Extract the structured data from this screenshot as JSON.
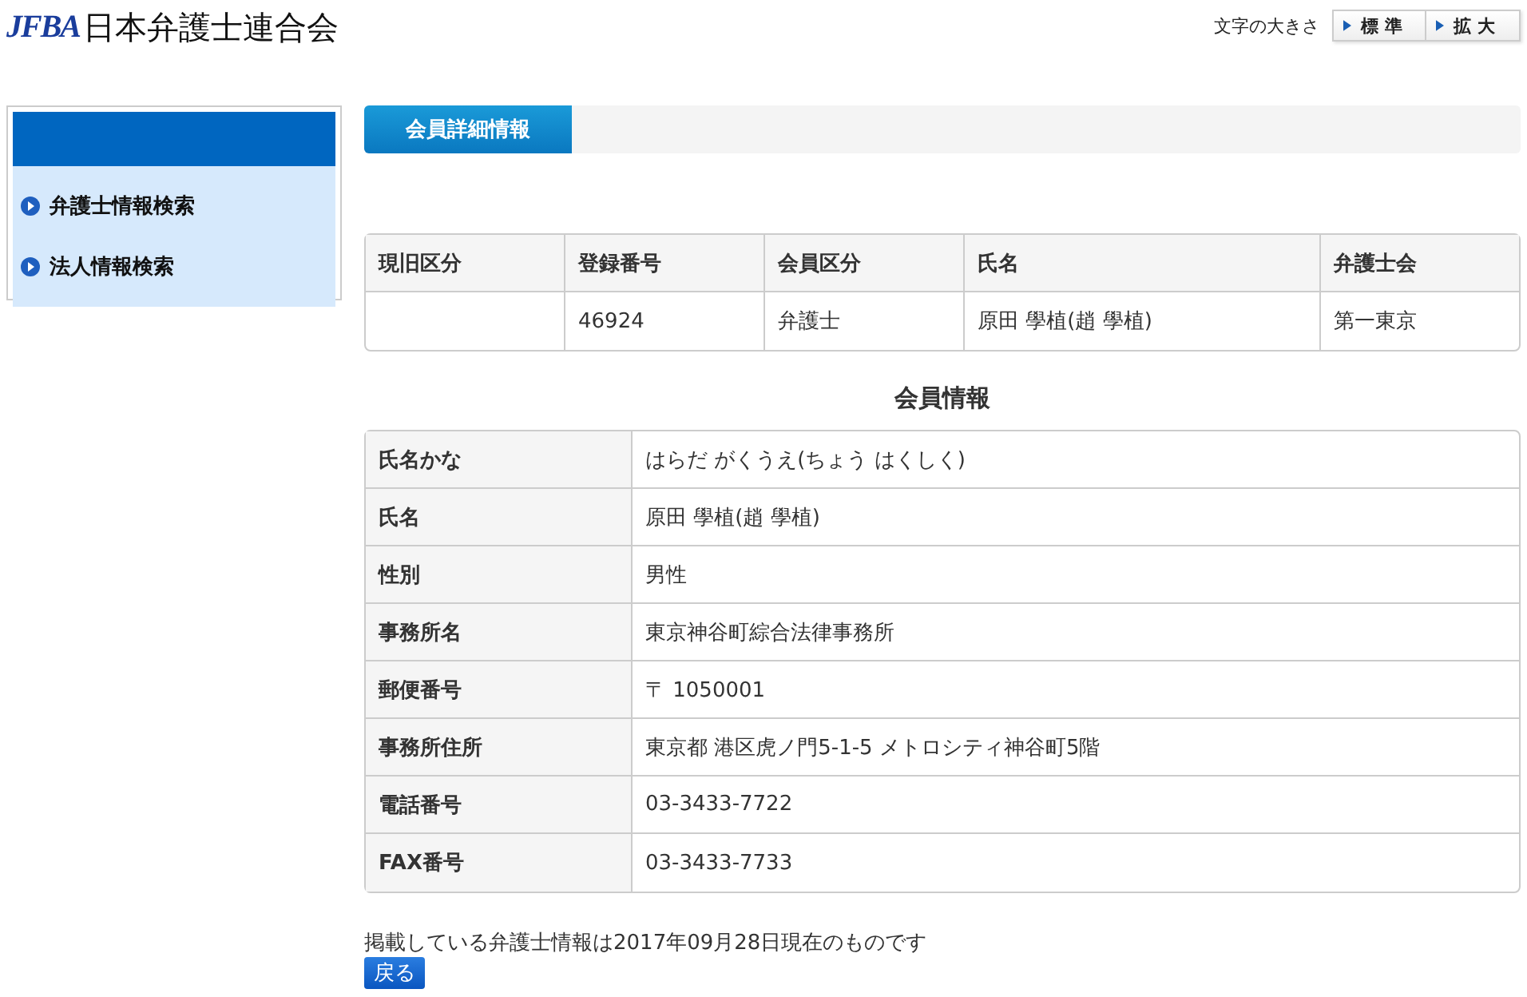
{
  "header": {
    "logo_mark": "JFBA",
    "logo_text": "日本弁護士連合会",
    "font_size_label": "文字の大きさ",
    "font_size_buttons": [
      {
        "label": "標 準"
      },
      {
        "label": "拡 大"
      }
    ]
  },
  "sidebar": {
    "items": [
      {
        "label": "弁護士情報検索"
      },
      {
        "label": "法人情報検索"
      }
    ]
  },
  "tab": {
    "label": "会員詳細情報"
  },
  "summary_table": {
    "columns": [
      "現旧区分",
      "登録番号",
      "会員区分",
      "氏名",
      "弁護士会"
    ],
    "rows": [
      [
        "",
        "46924",
        "弁護士",
        "原田 學植(趙 學植)",
        "第一東京"
      ]
    ]
  },
  "section_title": "会員情報",
  "details": [
    {
      "label": "氏名かな",
      "value": "はらだ がくうえ(ちょう はくしく)"
    },
    {
      "label": "氏名",
      "value": "原田 學植(趙 學植)"
    },
    {
      "label": "性別",
      "value": "男性"
    },
    {
      "label": "事務所名",
      "value": "東京神谷町綜合法律事務所"
    },
    {
      "label": "郵便番号",
      "value": "〒 1050001"
    },
    {
      "label": "事務所住所",
      "value": "東京都 港区虎ノ門5-1-5 メトロシティ神谷町5階"
    },
    {
      "label": "電話番号",
      "value": "03-3433-7722"
    },
    {
      "label": "FAX番号",
      "value": "03-3433-7733"
    }
  ],
  "footer_note": "掲載している弁護士情報は2017年09月28日現在のものです",
  "back_button": "戻る"
}
